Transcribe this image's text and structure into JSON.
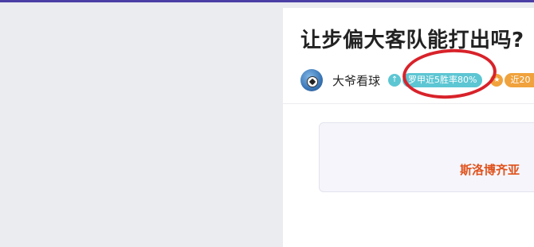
{
  "article": {
    "title": "让步偏大客队能打出吗?",
    "author": {
      "name": "大爷看球",
      "avatar_icon": "soccer-ball-avatar"
    },
    "badges": [
      {
        "icon": "up-arrow-icon",
        "icon_glyph": "↑",
        "label": "罗甲近5胜率80%",
        "color": "#5dc6d3"
      },
      {
        "icon": "star-icon",
        "icon_glyph": "★",
        "label": "近20",
        "color": "#f0a23c"
      }
    ]
  },
  "match_card": {
    "team": "斯洛博齐亚"
  },
  "colors": {
    "topbar": "#4b3fa6",
    "annotation_circle": "#d8222a",
    "team_text": "#e0521c"
  }
}
